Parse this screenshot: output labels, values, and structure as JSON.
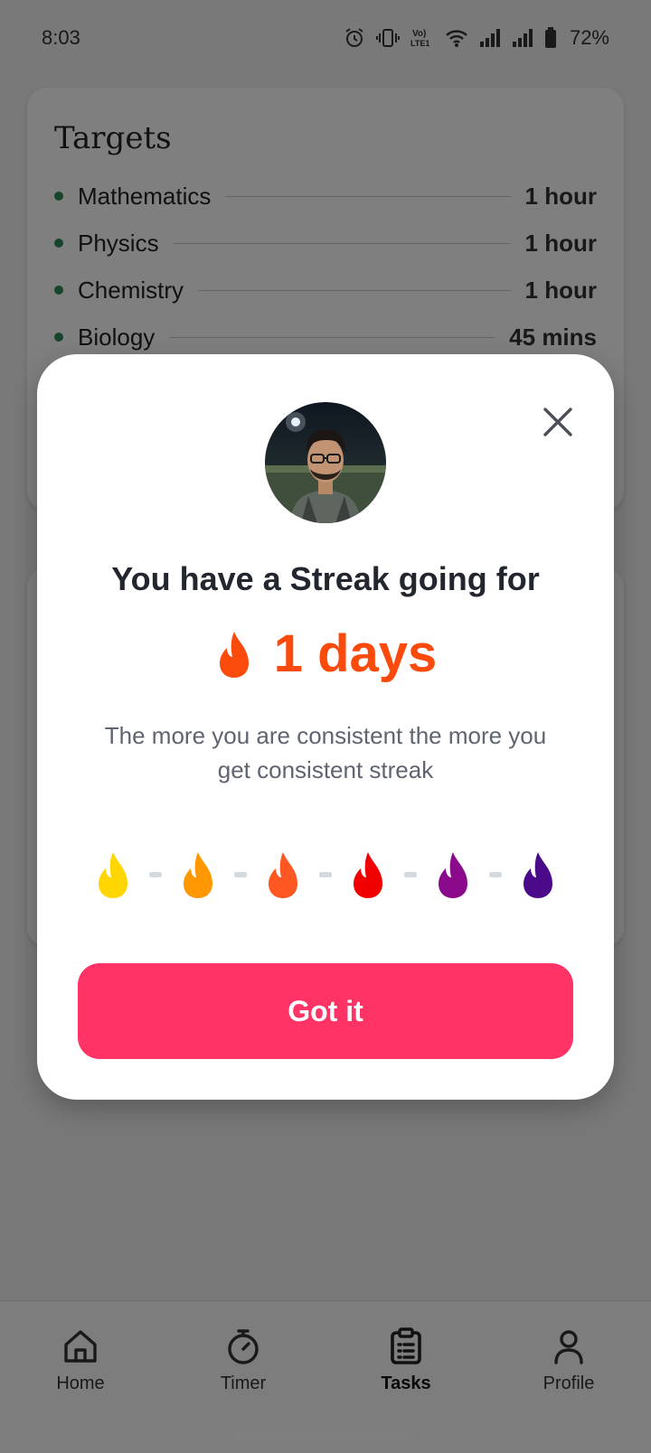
{
  "status_bar": {
    "time": "8:03",
    "battery_percent": "72%",
    "icons": [
      "alarm-icon",
      "vibrate-icon",
      "volte-icon",
      "wifi-icon",
      "signal-icon",
      "signal-icon",
      "battery-icon"
    ]
  },
  "targets": {
    "title": "Targets",
    "items": [
      {
        "subject": "Mathematics",
        "duration": "1 hour"
      },
      {
        "subject": "Physics",
        "duration": "1 hour"
      },
      {
        "subject": "Chemistry",
        "duration": "1 hour"
      },
      {
        "subject": "Biology",
        "duration": "45 mins"
      }
    ]
  },
  "modal": {
    "heading": "You have a Streak going for",
    "streak_count": "1 days",
    "description": "The more you are consistent the more you get consistent streak",
    "button_label": "Got it",
    "streak_level_colors": [
      "#FFD600",
      "#FF9800",
      "#FF5722",
      "#F00000",
      "#8B0A8B",
      "#4B0A8A"
    ],
    "accent_color": "#FA4A0C",
    "button_color": "#FF3366"
  },
  "bottom_nav": {
    "items": [
      {
        "label": "Home",
        "icon": "home-icon"
      },
      {
        "label": "Timer",
        "icon": "timer-icon"
      },
      {
        "label": "Tasks",
        "icon": "tasks-icon",
        "active": true
      },
      {
        "label": "Profile",
        "icon": "profile-icon"
      }
    ]
  }
}
